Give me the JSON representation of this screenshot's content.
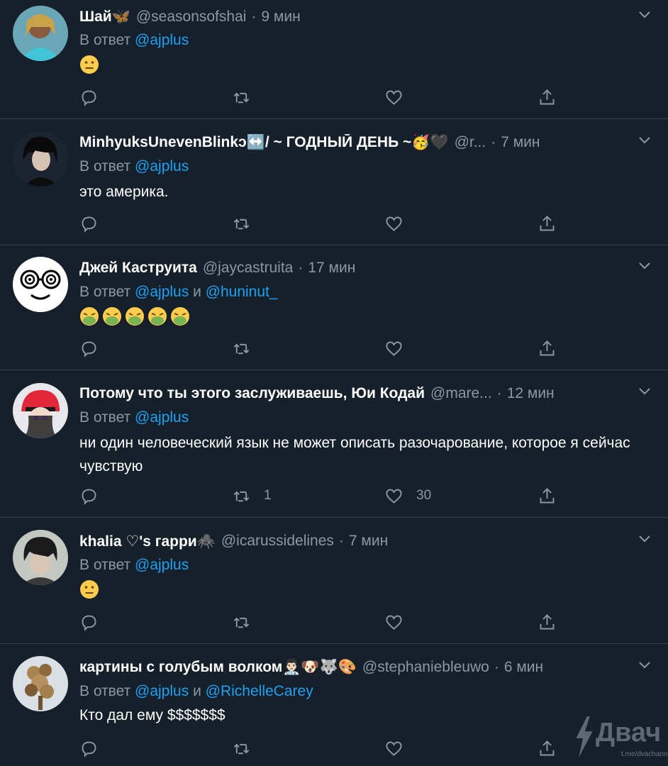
{
  "tweets": [
    {
      "name": "Шай🦋",
      "handle": "@seasonsofshai",
      "time": "9 мин",
      "reply_prefix": "В ответ",
      "mentions": [
        "@ajplus"
      ],
      "reply_joiner": "",
      "text": "",
      "emoji_faces": 1,
      "emoji_kind": "neutral",
      "retweets": "",
      "likes": ""
    },
    {
      "name": "MinhyuksUnevenBlinkↄ↔️/ ~ ГОДНЫЙ ДЕНЬ ~🥳🖤",
      "handle": "@r...",
      "time": "7 мин",
      "reply_prefix": "В ответ",
      "mentions": [
        "@ajplus"
      ],
      "reply_joiner": "",
      "text": "это америка.",
      "emoji_faces": 0,
      "emoji_kind": "",
      "retweets": "",
      "likes": ""
    },
    {
      "name": "Джей Каструита",
      "handle": "@jaycastruita",
      "time": "17 мин",
      "reply_prefix": "В ответ",
      "mentions": [
        "@ajplus",
        "@huninut_"
      ],
      "reply_joiner": "и",
      "text": "",
      "emoji_faces": 5,
      "emoji_kind": "vomit",
      "retweets": "",
      "likes": ""
    },
    {
      "name": "Потому что ты этого заслуживаешь, Юи Кодай",
      "handle": "@mare...",
      "time": "12 мин",
      "reply_prefix": "В ответ",
      "mentions": [
        "@ajplus"
      ],
      "reply_joiner": "",
      "text": "ни один человеческий язык не может описать разочарование, которое я сейчас чувствую",
      "emoji_faces": 0,
      "emoji_kind": "",
      "retweets": "1",
      "likes": "30"
    },
    {
      "name": "khalia ♡'s гарри🕷️",
      "handle": "@icarussidelines",
      "time": "7 мин",
      "reply_prefix": "В ответ",
      "mentions": [
        "@ajplus"
      ],
      "reply_joiner": "",
      "text": "",
      "emoji_faces": 1,
      "emoji_kind": "neutral",
      "retweets": "",
      "likes": ""
    },
    {
      "name": "картины с голубым волком👨🏻‍⚕️🐶🐺🎨",
      "handle": "@stephaniebleuwo",
      "time": "6 мин",
      "reply_prefix": "В ответ",
      "mentions": [
        "@ajplus",
        "@RichelleCarey"
      ],
      "reply_joiner": "и",
      "text": "Кто дал ему $$$$$$$",
      "emoji_faces": 0,
      "emoji_kind": "",
      "retweets": "",
      "likes": ""
    }
  ],
  "watermark": {
    "brand": "Двач",
    "sub": "t.me/dvachannel"
  },
  "colors": {
    "background": "#15202b",
    "border": "#38444d",
    "muted": "#8899a6",
    "link": "#1da1f2"
  },
  "icons": [
    "reply-icon",
    "retweet-icon",
    "like-icon",
    "share-icon",
    "chevron-down-icon"
  ]
}
